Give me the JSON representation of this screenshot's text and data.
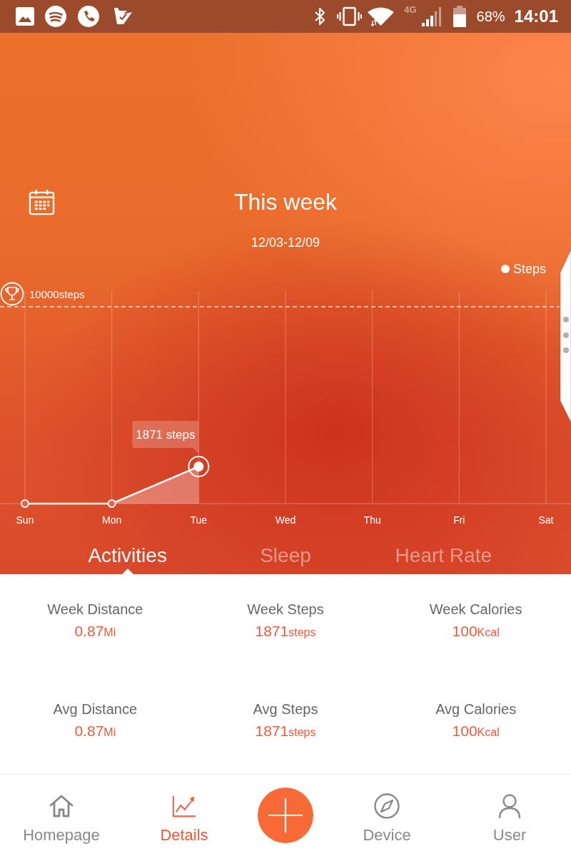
{
  "status_bar": {
    "network": "4G",
    "battery": "68%",
    "time": "14:01"
  },
  "header": {
    "title": "This week",
    "date_range": "12/03-12/09"
  },
  "chart": {
    "legend": "Steps",
    "goal_label": "10000steps",
    "tooltip": "1871 steps",
    "days": [
      {
        "label": "Sun",
        "selected": false
      },
      {
        "label": "Mon",
        "selected": false
      },
      {
        "label": "Tue",
        "selected": true
      },
      {
        "label": "Wed",
        "selected": false
      },
      {
        "label": "Thu",
        "selected": false
      },
      {
        "label": "Fri",
        "selected": false
      },
      {
        "label": "Sat",
        "selected": false
      }
    ]
  },
  "tabs": [
    {
      "label": "Activities",
      "selected": true
    },
    {
      "label": "Sleep",
      "selected": false
    },
    {
      "label": "Heart Rate",
      "selected": false
    }
  ],
  "stats": [
    {
      "label": "Week Distance",
      "value": "0.87",
      "unit": "Mi"
    },
    {
      "label": "Week Steps",
      "value": "1871",
      "unit": "steps"
    },
    {
      "label": "Week Calories",
      "value": "100",
      "unit": "Kcal"
    },
    {
      "label": "Avg Distance",
      "value": "0.87",
      "unit": "Mi"
    },
    {
      "label": "Avg Steps",
      "value": "1871",
      "unit": "steps"
    },
    {
      "label": "Avg Calories",
      "value": "100",
      "unit": "Kcal"
    }
  ],
  "nav": [
    {
      "kind": "tab",
      "label": "Homepage",
      "selected": false
    },
    {
      "kind": "tab",
      "label": "Details",
      "selected": true
    },
    {
      "kind": "add"
    },
    {
      "kind": "tab",
      "label": "Device",
      "selected": false
    },
    {
      "kind": "tab",
      "label": "User",
      "selected": false
    }
  ]
}
